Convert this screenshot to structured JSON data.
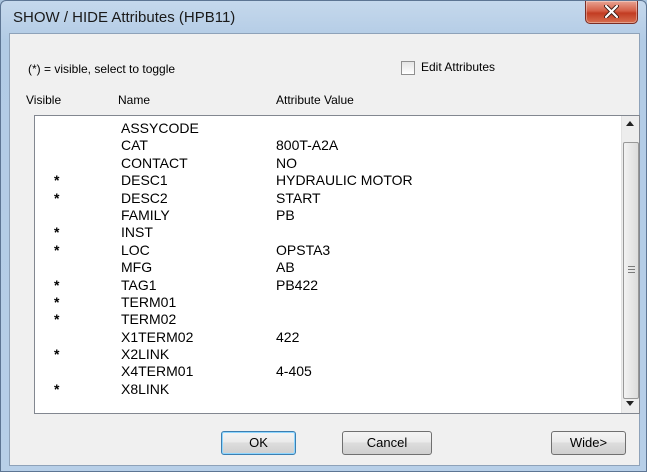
{
  "window": {
    "title": "SHOW / HIDE Attributes (HPB11)",
    "close_icon": "close-x-icon"
  },
  "hint_text": "(*) = visible, select to toggle",
  "edit_attributes": {
    "label": "Edit Attributes",
    "checked": false
  },
  "columns": {
    "visible": "Visible",
    "name": "Name",
    "value": "Attribute Value"
  },
  "rows": [
    {
      "visible": "",
      "name": "ASSYCODE",
      "value": ""
    },
    {
      "visible": "",
      "name": "CAT",
      "value": "800T-A2A"
    },
    {
      "visible": "",
      "name": "CONTACT",
      "value": "NO"
    },
    {
      "visible": "*",
      "name": "DESC1",
      "value": "HYDRAULIC MOTOR"
    },
    {
      "visible": "*",
      "name": "DESC2",
      "value": "START"
    },
    {
      "visible": "",
      "name": "FAMILY",
      "value": "PB"
    },
    {
      "visible": "*",
      "name": "INST",
      "value": ""
    },
    {
      "visible": "*",
      "name": "LOC",
      "value": "OPSTA3"
    },
    {
      "visible": "",
      "name": "MFG",
      "value": "AB"
    },
    {
      "visible": "*",
      "name": "TAG1",
      "value": "PB422"
    },
    {
      "visible": "*",
      "name": "TERM01",
      "value": ""
    },
    {
      "visible": "*",
      "name": "TERM02",
      "value": ""
    },
    {
      "visible": "",
      "name": "X1TERM02",
      "value": "422"
    },
    {
      "visible": "*",
      "name": "X2LINK",
      "value": ""
    },
    {
      "visible": "",
      "name": "X4TERM01",
      "value": "4-405"
    },
    {
      "visible": "*",
      "name": "X8LINK",
      "value": ""
    }
  ],
  "buttons": {
    "ok": "OK",
    "cancel": "Cancel",
    "wide": "Wide>"
  }
}
